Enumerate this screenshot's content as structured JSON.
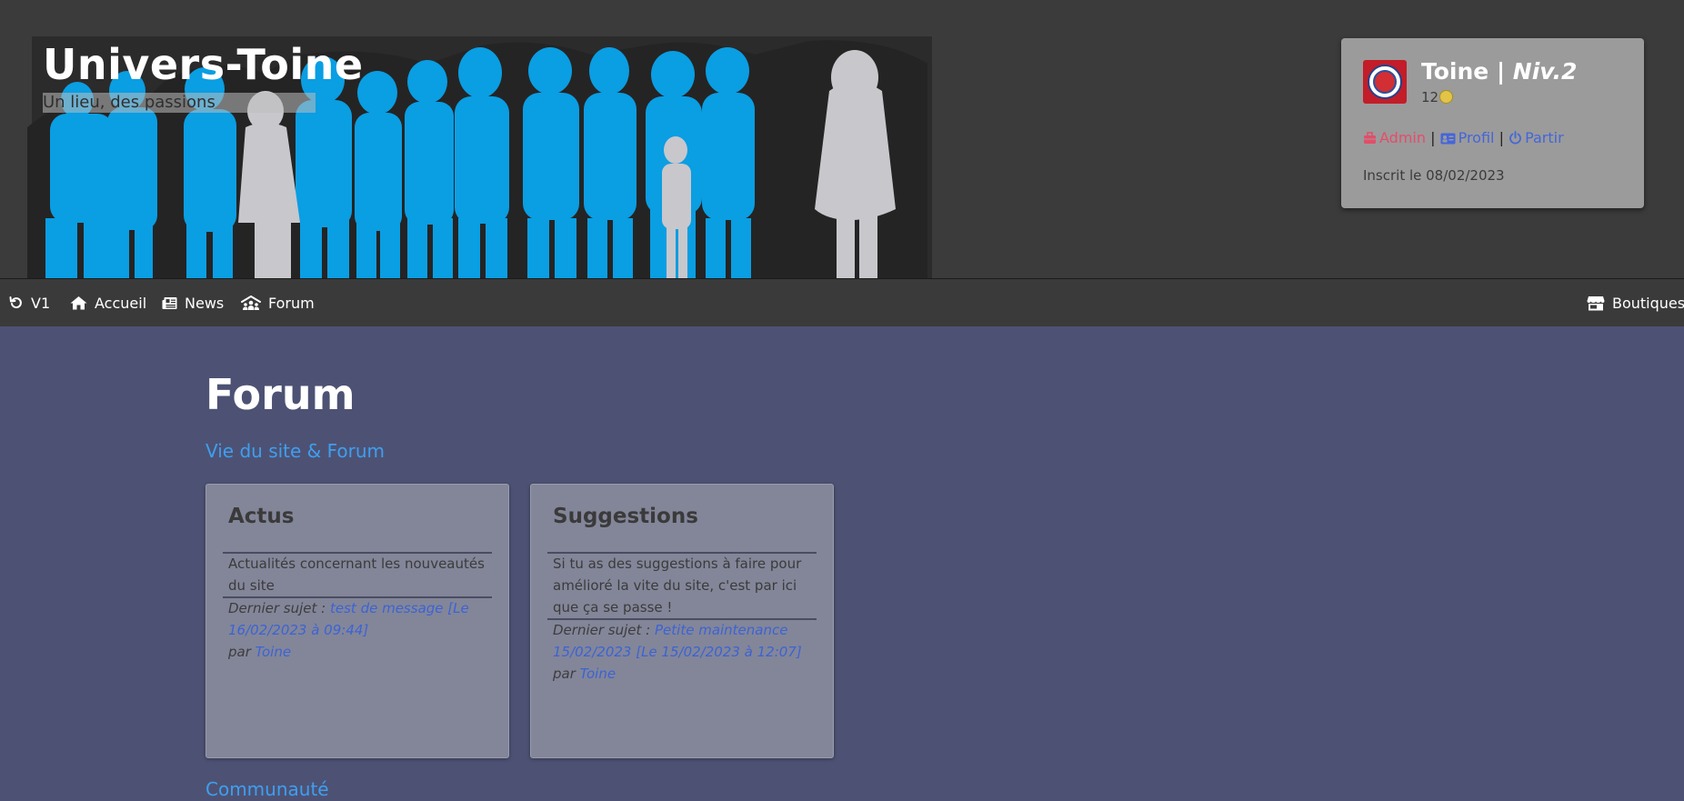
{
  "header": {
    "title": "Univers-Toine",
    "tagline": "Un lieu, des passions"
  },
  "user": {
    "name": "Toine",
    "separator": " | ",
    "level": "Niv.2",
    "coins": "12",
    "links": {
      "admin": "Admin",
      "profil": "Profil",
      "partir": "Partir",
      "sep": "|"
    },
    "registered": "Inscrit le 08/02/2023"
  },
  "nav": {
    "v1": "V1",
    "accueil": "Accueil",
    "news": "News",
    "forum": "Forum",
    "boutiques": "Boutiques"
  },
  "main": {
    "title": "Forum",
    "sections": [
      {
        "title": "Vie du site & Forum",
        "cards": [
          {
            "title": "Actus",
            "description": "Actualités concernant les nouveautés du site",
            "last_label": "Dernier sujet :",
            "last_topic": "test de message [Le 16/02/2023 à 09:44]",
            "by_label": "par",
            "author": "Toine"
          },
          {
            "title": "Suggestions",
            "description": "Si tu as des suggestions à faire pour amélioré la vite du site, c'est par ici que ça se passe !",
            "last_label": "Dernier sujet :",
            "last_topic": "Petite maintenance 15/02/2023 [Le 15/02/2023 à 12:07]",
            "by_label": "par",
            "author": "Toine"
          }
        ]
      },
      {
        "title": "Communauté"
      }
    ]
  },
  "colors": {
    "page_bg": "#4d5274",
    "header_bg": "#3c3b3b",
    "banner_blue": "#0a9ee3",
    "banner_white": "#c8c7cc",
    "admin_link": "#e44d6a",
    "link_blue": "#4466d8",
    "section_title": "#3f9ef0"
  }
}
